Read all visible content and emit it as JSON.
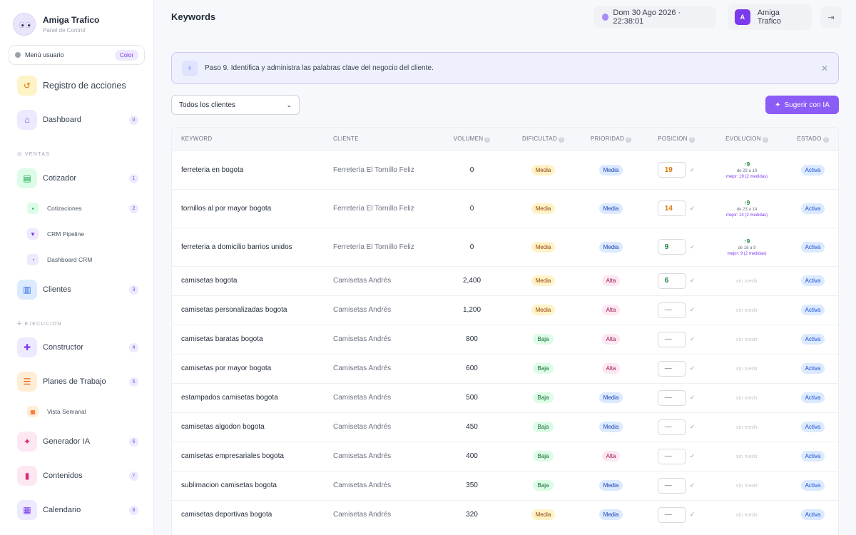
{
  "brand": {
    "title": "Amiga Trafico",
    "subtitle": "Panel de Control"
  },
  "user_menu": {
    "label": "Menú usuario",
    "color_label": "Color"
  },
  "sidebar": {
    "top_item": {
      "label": "Registro de acciones",
      "icon": "history-icon"
    },
    "dashboard": {
      "label": "Dashboard",
      "badge": "0"
    },
    "section_ventas": "VENTAS",
    "cotizador": {
      "label": "Cotizador",
      "badge": "1"
    },
    "sub_cotizaciones": {
      "label": "Cotizaciones",
      "badge": "2"
    },
    "sub_crm_pipeline": {
      "label": "CRM Pipeline"
    },
    "sub_dashboard_crm": {
      "label": "Dashboard CRM"
    },
    "clientes": {
      "label": "Clientes",
      "badge": "3"
    },
    "section_ejecucion": "EJECUCION",
    "constructor": {
      "label": "Constructor",
      "badge": "4"
    },
    "planes": {
      "label": "Planes de Trabajo",
      "badge": "5"
    },
    "sub_vista_semanal": {
      "label": "Vista Semanal"
    },
    "generador": {
      "label": "Generador IA",
      "badge": "6"
    },
    "contenidos": {
      "label": "Contenidos",
      "badge": "7"
    },
    "calendario": {
      "label": "Calendario",
      "badge": "8"
    }
  },
  "header": {
    "title": "Keywords",
    "datetime": "Dom 30 Ago 2026 · 22:38:01",
    "user_initial": "A",
    "user_name": "Amiga Trafico"
  },
  "banner": {
    "text": "Paso 9. Identifica y administra las palabras clave del negocio del cliente."
  },
  "filter": {
    "selected": "Todos los clientes"
  },
  "suggest_button": "Sugerir con IA",
  "table": {
    "headers": {
      "keyword": "KEYWORD",
      "cliente": "CLIENTE",
      "volumen": "VOLUMEN",
      "dificultad": "DIFICULTAD",
      "prioridad": "PRIORIDAD",
      "posicion": "POSICION",
      "evolucion": "EVOLUCION",
      "estado": "ESTADO"
    },
    "rows": [
      {
        "keyword": "ferreteria en bogota",
        "cliente": "Ferretería El Tornillo Feliz",
        "volumen": "0",
        "dificultad": "Media",
        "prioridad": "Media",
        "posicion": "19",
        "pos_color": "orange",
        "evo": "↑9",
        "evo_range": "de 28 a 19",
        "evo_best": "mejor: 19 (2 medidas)",
        "estado": "Activa"
      },
      {
        "keyword": "tornillos al por mayor bogota",
        "cliente": "Ferretería El Tornillo Feliz",
        "volumen": "0",
        "dificultad": "Media",
        "prioridad": "Media",
        "posicion": "14",
        "pos_color": "orange",
        "evo": "↑9",
        "evo_range": "de 23 a 14",
        "evo_best": "mejor: 14 (2 medidas)",
        "estado": "Activa"
      },
      {
        "keyword": "ferreteria a domicilio barrios unidos",
        "cliente": "Ferretería El Tornillo Feliz",
        "volumen": "0",
        "dificultad": "Media",
        "prioridad": "Media",
        "posicion": "9",
        "pos_color": "green",
        "evo": "↑9",
        "evo_range": "de 18 a 9",
        "evo_best": "mejor: 9 (2 medidas)",
        "estado": "Activa"
      },
      {
        "keyword": "camisetas bogota",
        "cliente": "Camisetas Andrés",
        "volumen": "2,400",
        "dificultad": "Media",
        "prioridad": "Alta",
        "posicion": "6",
        "pos_color": "green",
        "evo_none": "sin medir",
        "estado": "Activa"
      },
      {
        "keyword": "camisetas personalizadas bogota",
        "cliente": "Camisetas Andrés",
        "volumen": "1,200",
        "dificultad": "Media",
        "prioridad": "Alta",
        "posicion": "—",
        "pos_color": "empty",
        "evo_none": "sin medir",
        "estado": "Activa"
      },
      {
        "keyword": "camisetas baratas bogota",
        "cliente": "Camisetas Andrés",
        "volumen": "800",
        "dificultad": "Baja",
        "prioridad": "Alta",
        "posicion": "—",
        "pos_color": "empty",
        "evo_none": "sin medir",
        "estado": "Activa"
      },
      {
        "keyword": "camisetas por mayor bogota",
        "cliente": "Camisetas Andrés",
        "volumen": "600",
        "dificultad": "Baja",
        "prioridad": "Alta",
        "posicion": "—",
        "pos_color": "empty",
        "evo_none": "sin medir",
        "estado": "Activa"
      },
      {
        "keyword": "estampados camisetas bogota",
        "cliente": "Camisetas Andrés",
        "volumen": "500",
        "dificultad": "Baja",
        "prioridad": "Media",
        "posicion": "—",
        "pos_color": "empty",
        "evo_none": "sin medir",
        "estado": "Activa"
      },
      {
        "keyword": "camisetas algodon bogota",
        "cliente": "Camisetas Andrés",
        "volumen": "450",
        "dificultad": "Baja",
        "prioridad": "Media",
        "posicion": "—",
        "pos_color": "empty",
        "evo_none": "sin medir",
        "estado": "Activa"
      },
      {
        "keyword": "camisetas empresariales bogota",
        "cliente": "Camisetas Andrés",
        "volumen": "400",
        "dificultad": "Baja",
        "prioridad": "Alta",
        "posicion": "—",
        "pos_color": "empty",
        "evo_none": "sin medir",
        "estado": "Activa"
      },
      {
        "keyword": "sublimacion camisetas bogota",
        "cliente": "Camisetas Andrés",
        "volumen": "350",
        "dificultad": "Baja",
        "prioridad": "Media",
        "posicion": "—",
        "pos_color": "empty",
        "evo_none": "sin medir",
        "estado": "Activa"
      },
      {
        "keyword": "camisetas deportivas bogota",
        "cliente": "Camisetas Andrés",
        "volumen": "320",
        "dificultad": "Media",
        "prioridad": "Media",
        "posicion": "—",
        "pos_color": "empty",
        "evo_none": "sin medir",
        "estado": "Activa"
      }
    ]
  },
  "colors": {
    "accent": "#8b5cf6",
    "banner_bg": "#eef0fe"
  }
}
